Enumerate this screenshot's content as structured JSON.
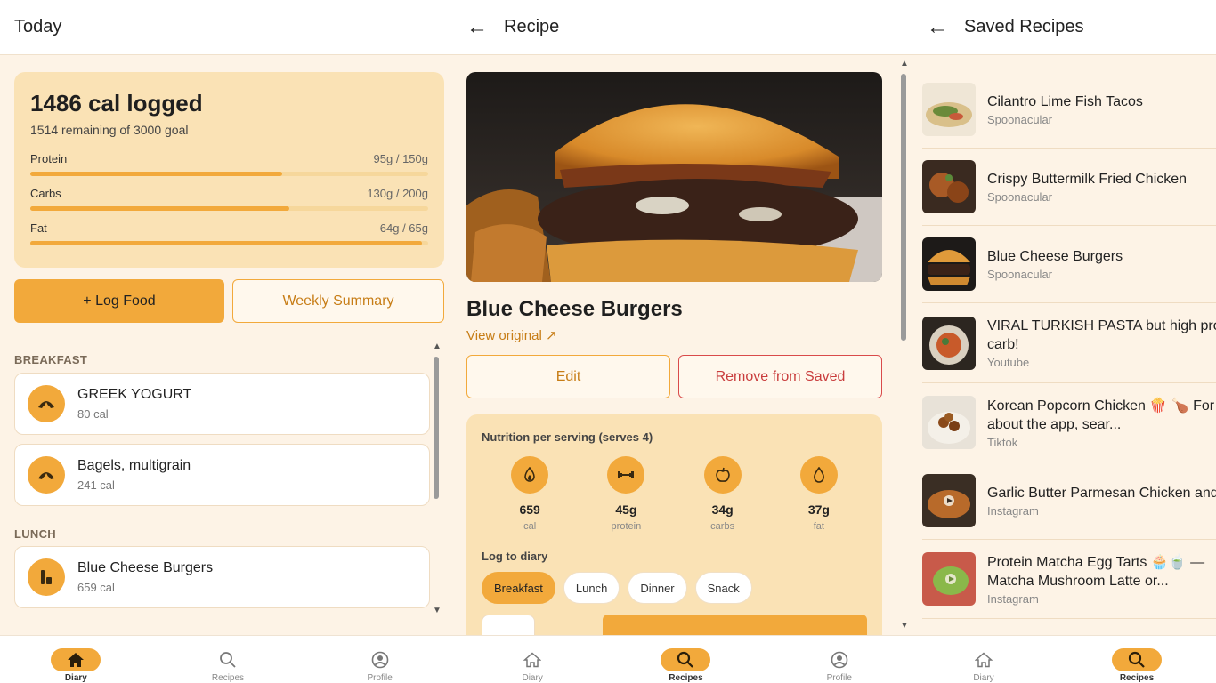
{
  "diary": {
    "title": "Today",
    "calories_logged": "1486 cal logged",
    "remaining": "1514 remaining of 3000 goal",
    "macros": [
      {
        "label": "Protein",
        "value": "95g / 150g",
        "fraction": 0.633
      },
      {
        "label": "Carbs",
        "value": "130g / 200g",
        "fraction": 0.65
      },
      {
        "label": "Fat",
        "value": "64g / 65g",
        "fraction": 0.985
      }
    ],
    "log_food_label": "+ Log Food",
    "weekly_summary_label": "Weekly Summary",
    "sections": [
      {
        "name": "BREAKFAST",
        "items": [
          {
            "name": "GREEK YOGURT",
            "cal": "80 cal",
            "icon": "croissant-icon"
          },
          {
            "name": "Bagels, multigrain",
            "cal": "241 cal",
            "icon": "croissant-icon"
          }
        ]
      },
      {
        "name": "LUNCH",
        "items": [
          {
            "name": "Blue Cheese Burgers",
            "cal": "659 cal",
            "icon": "drink-icon"
          }
        ]
      }
    ]
  },
  "recipe": {
    "title": "Recipe",
    "name": "Blue Cheese Burgers",
    "view_original": "View original ↗",
    "edit_label": "Edit",
    "remove_label": "Remove from Saved",
    "nutrition_heading": "Nutrition per serving (serves 4)",
    "nutrition": [
      {
        "value": "659",
        "label": "cal",
        "icon": "flame-icon"
      },
      {
        "value": "45g",
        "label": "protein",
        "icon": "dumbbell-icon"
      },
      {
        "value": "34g",
        "label": "carbs",
        "icon": "apple-icon"
      },
      {
        "value": "37g",
        "label": "fat",
        "icon": "drop-icon"
      }
    ],
    "log_to_diary": "Log to diary",
    "meals": [
      "Breakfast",
      "Lunch",
      "Dinner",
      "Snack"
    ],
    "selected_meal": "Breakfast"
  },
  "saved": {
    "title": "Saved Recipes",
    "items": [
      {
        "title": "Cilantro Lime Fish Tacos",
        "title2": "",
        "source": "Spoonacular"
      },
      {
        "title": "Crispy Buttermilk Fried Chicken",
        "title2": "",
        "source": "Spoonacular"
      },
      {
        "title": "Blue Cheese Burgers",
        "title2": "",
        "source": "Spoonacular"
      },
      {
        "title": "VIRAL TURKISH PASTA but high pro",
        "title2": "carb!",
        "source": "Youtube"
      },
      {
        "title": "Korean Popcorn Chicken 🍿 🍗 For",
        "title2": "about the app, sear...",
        "source": "Tiktok"
      },
      {
        "title": "Garlic Butter Parmesan Chicken and",
        "title2": "",
        "source": "Instagram"
      },
      {
        "title": "Protein Matcha Egg Tarts 🧁🍵 —",
        "title2": "Matcha Mushroom Latte or...",
        "source": "Instagram"
      }
    ]
  },
  "nav": {
    "diary": "Diary",
    "recipes": "Recipes",
    "profile": "Profile"
  },
  "colors": {
    "accent": "#f2a93b",
    "background": "#fdf3e6",
    "card": "#fae2b5",
    "danger": "#d94a4a"
  }
}
